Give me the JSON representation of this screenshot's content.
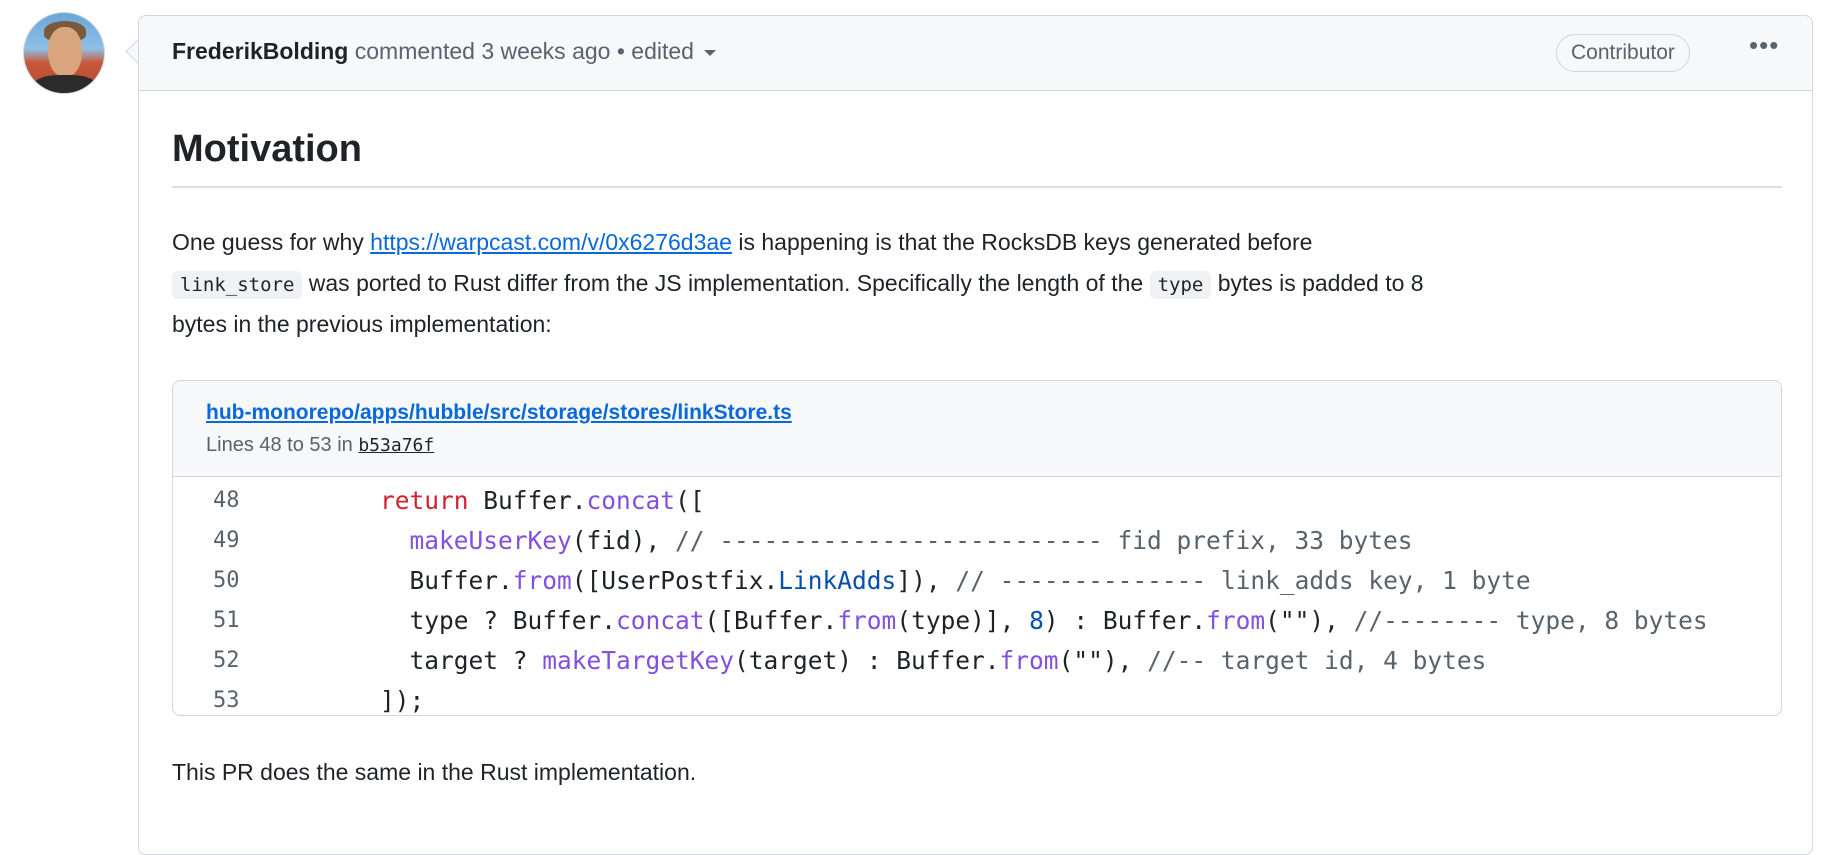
{
  "comment": {
    "author": "FrederikBolding",
    "action": "commented",
    "time": "3 weeks ago",
    "separator": "•",
    "edited": "edited",
    "badge": "Contributor",
    "more": "•••"
  },
  "body": {
    "heading": "Motivation",
    "para1": {
      "line1_pre": "One guess for why ",
      "link": "https://warpcast.com/v/0x6276d3ae",
      "line1_post": " is happening is that the RocksDB keys generated before",
      "code1": "link_store",
      "line2_mid": " was ported to Rust differ from the JS implementation. Specifically the length of the ",
      "code2": "type",
      "line2_post": " bytes is padded to 8",
      "line3": "bytes in the previous implementation:"
    },
    "snippet": {
      "path": "hub-monorepo/apps/hubble/src/storage/stores/linkStore.ts",
      "lines_label": "Lines 48 to 53 in",
      "sha": "b53a76f",
      "lines": [
        {
          "num": "48",
          "tokens": [
            [
              "pl",
              "    "
            ],
            [
              "kw",
              "return"
            ],
            [
              "pl",
              " Buffer."
            ],
            [
              "fn",
              "concat"
            ],
            [
              "pl",
              "(["
            ]
          ]
        },
        {
          "num": "49",
          "tokens": [
            [
              "pl",
              "      "
            ],
            [
              "fn",
              "makeUserKey"
            ],
            [
              "pl",
              "(fid), "
            ],
            [
              "cm",
              "// -------------------------- fid prefix, 33 bytes"
            ]
          ]
        },
        {
          "num": "50",
          "tokens": [
            [
              "pl",
              "      Buffer."
            ],
            [
              "fn",
              "from"
            ],
            [
              "pl",
              "([UserPostfix."
            ],
            [
              "cst",
              "LinkAdds"
            ],
            [
              "pl",
              "]), "
            ],
            [
              "cm",
              "// -------------- link_adds key, 1 byte"
            ]
          ]
        },
        {
          "num": "51",
          "tokens": [
            [
              "pl",
              "      type ? Buffer."
            ],
            [
              "fn",
              "concat"
            ],
            [
              "pl",
              "([Buffer."
            ],
            [
              "fn",
              "from"
            ],
            [
              "pl",
              "(type)], "
            ],
            [
              "cst",
              "8"
            ],
            [
              "pl",
              ") : Buffer."
            ],
            [
              "fn",
              "from"
            ],
            [
              "pl",
              "(\"\"), "
            ],
            [
              "cm",
              "//-------- type, 8 bytes"
            ]
          ]
        },
        {
          "num": "52",
          "tokens": [
            [
              "pl",
              "      target ? "
            ],
            [
              "fn",
              "makeTargetKey"
            ],
            [
              "pl",
              "(target) : Buffer."
            ],
            [
              "fn",
              "from"
            ],
            [
              "pl",
              "(\"\"), "
            ],
            [
              "cm",
              "//-- target id, 4 bytes"
            ]
          ]
        },
        {
          "num": "53",
          "tokens": [
            [
              "pl",
              "    ]);"
            ]
          ]
        }
      ]
    },
    "para2": "This PR does the same in the Rust implementation."
  }
}
